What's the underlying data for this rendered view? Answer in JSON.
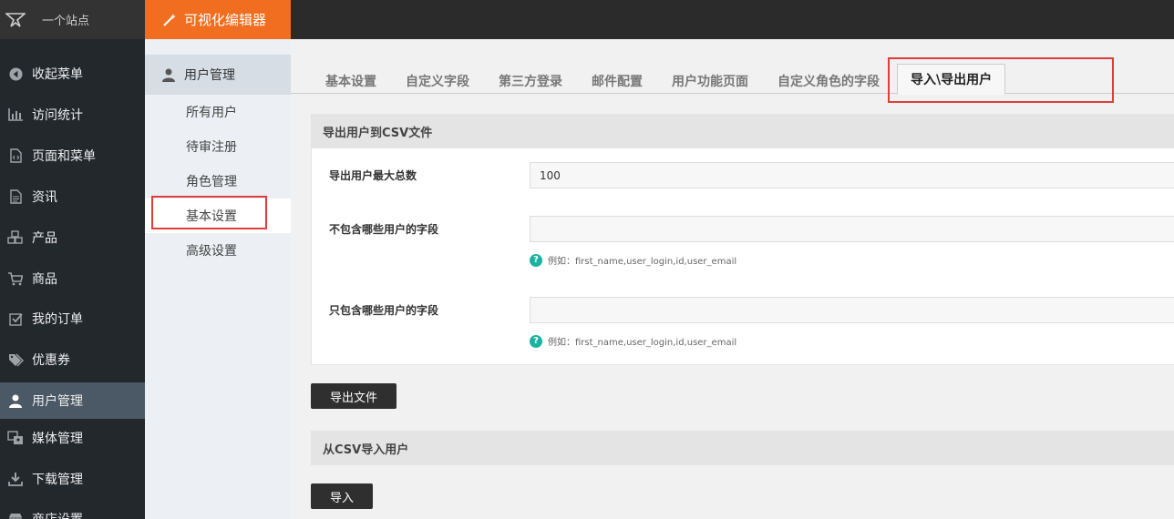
{
  "header": {
    "site_name": "一个站点",
    "editor_label": "可视化编辑器"
  },
  "sidebar": {
    "items": [
      {
        "label": "收起菜单",
        "icon": "collapse-icon"
      },
      {
        "label": "访问统计",
        "icon": "bar-chart-icon"
      },
      {
        "label": "页面和菜单",
        "icon": "page-code-icon"
      },
      {
        "label": "资讯",
        "icon": "document-icon"
      },
      {
        "label": "产品",
        "icon": "cubes-icon"
      },
      {
        "label": "商品",
        "icon": "cart-icon"
      },
      {
        "label": "我的订单",
        "icon": "checkbox-icon"
      },
      {
        "label": "优惠券",
        "icon": "tags-icon"
      },
      {
        "label": "用户管理",
        "icon": "user-icon"
      },
      {
        "label": "媒体管理",
        "icon": "media-icon"
      },
      {
        "label": "下载管理",
        "icon": "download-icon"
      },
      {
        "label": "商店设置",
        "icon": "store-icon"
      }
    ]
  },
  "subnav": {
    "heading": "用户管理",
    "items": [
      "所有用户",
      "待审注册",
      "角色管理",
      "基本设置",
      "高级设置"
    ]
  },
  "tabs": [
    "基本设置",
    "自定义字段",
    "第三方登录",
    "邮件配置",
    "用户功能页面",
    "自定义角色的字段",
    "导入\\导出用户"
  ],
  "export_section": {
    "title": "导出用户到CSV文件",
    "max_label": "导出用户最大总数",
    "max_value": "100",
    "exclude_label": "不包含哪些用户的字段",
    "exclude_value": "",
    "exclude_hint": "例如：first_name,user_login,id,user_email",
    "include_label": "只包含哪些用户的字段",
    "include_value": "",
    "include_hint": "例如：first_name,user_login,id,user_email",
    "button": "导出文件"
  },
  "import_section": {
    "title": "从CSV导入用户",
    "button": "导入"
  },
  "colors": {
    "accent": "#f16d1f",
    "highlight_box": "#e03c3c",
    "sidebar_bg": "#23282d",
    "hint_icon": "#1ab3a0"
  }
}
